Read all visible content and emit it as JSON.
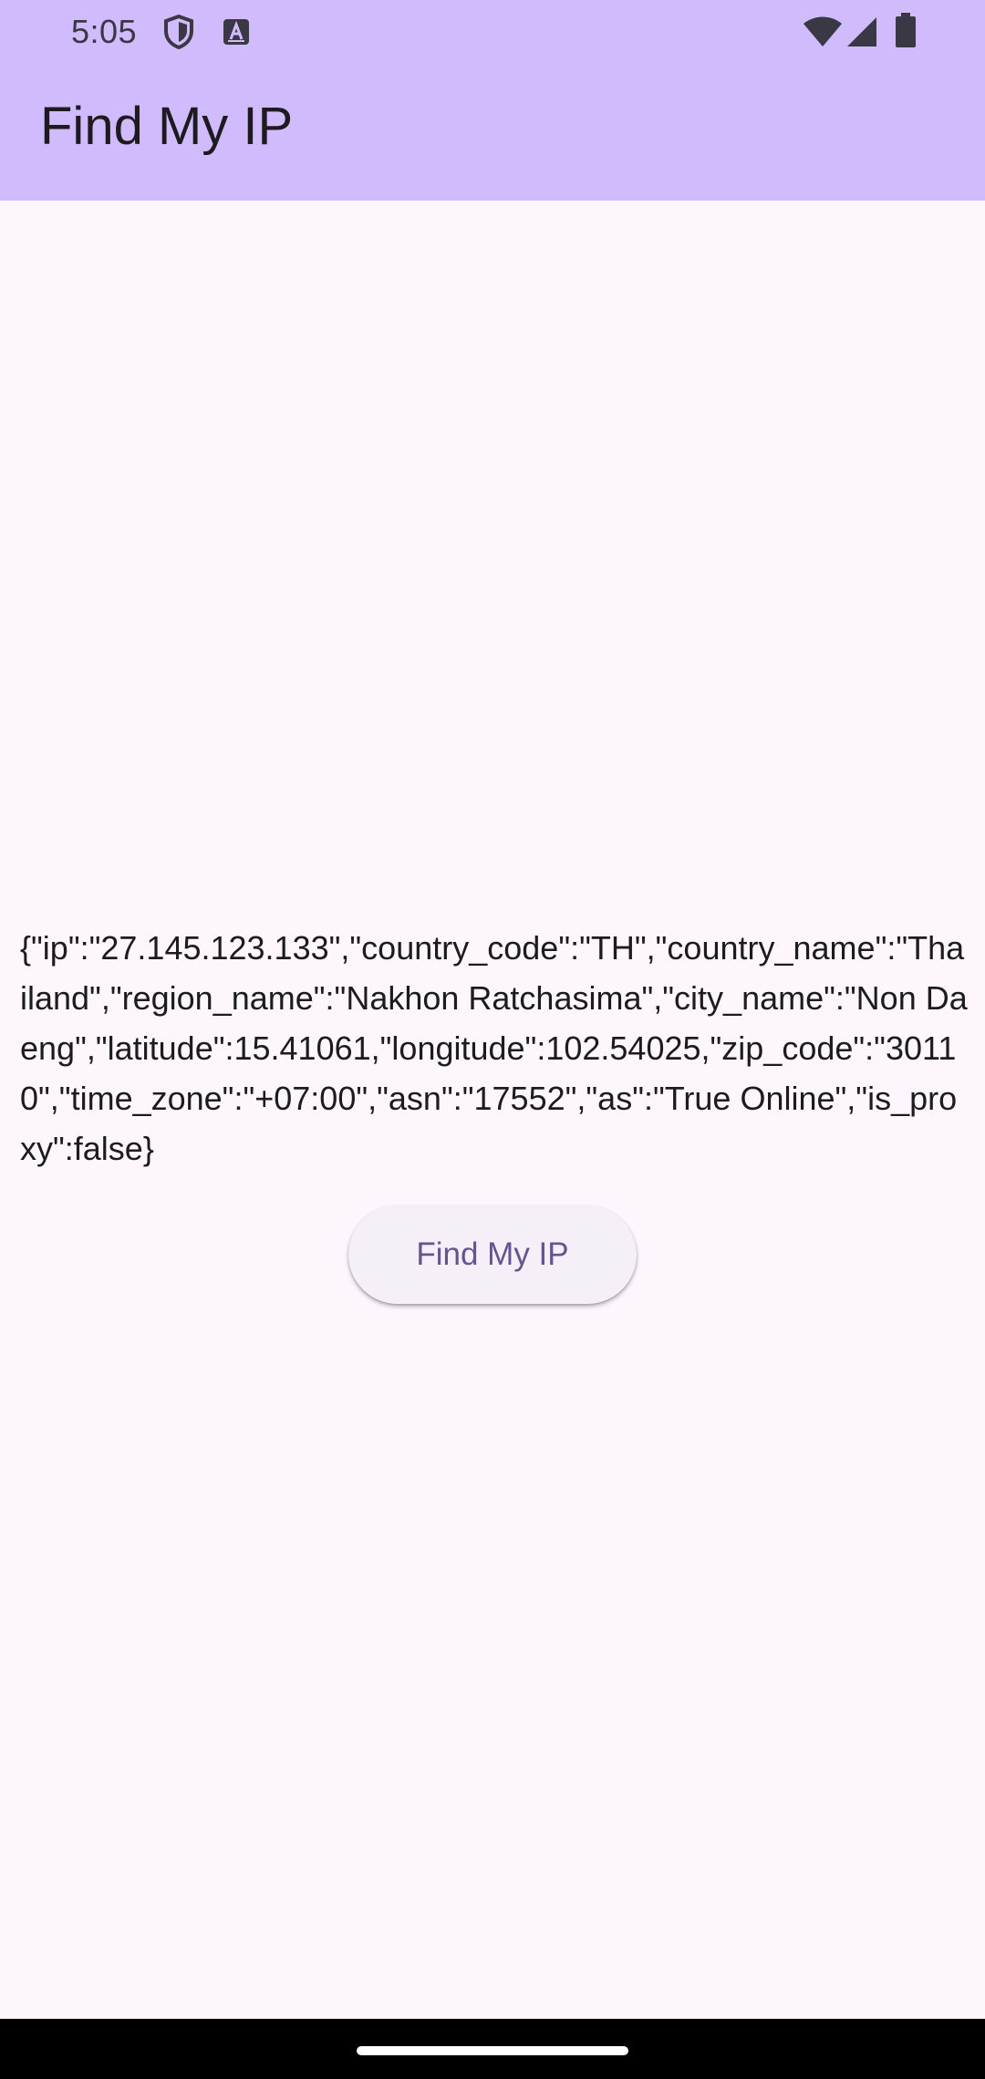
{
  "status_bar": {
    "time": "5:05",
    "icons_left": [
      "shield-icon",
      "a-notification-icon"
    ],
    "icons_right": [
      "wifi-icon",
      "cellular-signal-icon",
      "battery-icon"
    ]
  },
  "app_bar": {
    "title": "Find My IP"
  },
  "main": {
    "result_text": "{\"ip\":\"27.145.123.133\",\"country_code\":\"TH\",\"country_name\":\"Thailand\",\"region_name\":\"Nakhon Ratchasima\",\"city_name\":\"Non Daeng\",\"latitude\":15.41061,\"longitude\":102.54025,\"zip_code\":\"30110\",\"time_zone\":\"+07:00\",\"asn\":\"17552\",\"as\":\"True Online\",\"is_proxy\":false}",
    "button_label": "Find My IP"
  },
  "colors": {
    "app_bar_bg": "#d0bcfc",
    "page_bg": "#fdf7fd",
    "button_bg": "#f5eff7",
    "button_text": "#65558f",
    "text": "#1d1b20"
  }
}
